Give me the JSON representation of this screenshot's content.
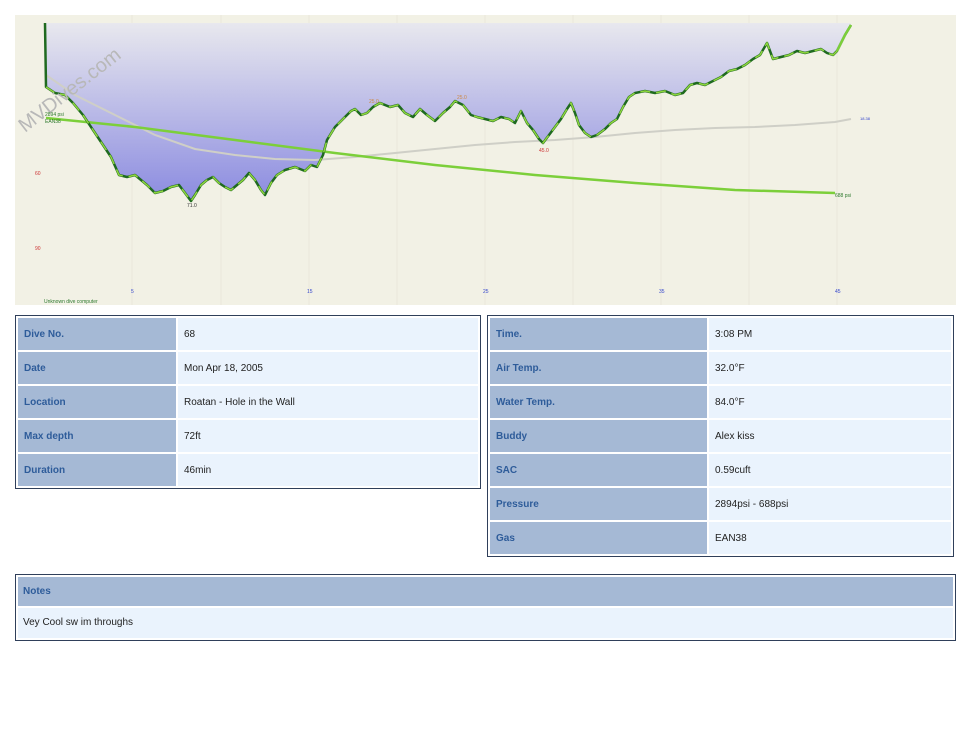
{
  "profile": {
    "watermark": "MVDives.com",
    "computer_label": "Unknown dive computer",
    "start_pressure_label": "2894 psi",
    "start_gas_label": "EAN38",
    "end_pressure_label": "688 psi",
    "temp_label": "18.38",
    "depth_ticks": [
      "60",
      "90"
    ],
    "time_ticks": [
      "5",
      "15",
      "25",
      "35",
      "45"
    ],
    "max_depth_label": "71.0",
    "mid_depth_label": "45.0",
    "peak_label_1": "25.0",
    "peak_label_2": "25.0",
    "colors": {
      "profile_fill_top": "#e6e6ee",
      "profile_fill_bottom": "#8e8ee0",
      "line_green": "#7ccf3a",
      "line_dark": "#1f6a1f",
      "line_yellow": "#d8d83a",
      "pressure": "#7ccf3a",
      "temp": "#cfcfc7",
      "background": "#f2f1e5",
      "axis_red": "#cc3333",
      "axis_blue": "#3344cc"
    }
  },
  "left": [
    {
      "label": "Dive No.",
      "value": "68"
    },
    {
      "label": "Date",
      "value": "Mon Apr 18, 2005"
    },
    {
      "label": "Location",
      "value": "Roatan - Hole in the Wall"
    },
    {
      "label": "Max depth",
      "value": "72ft"
    },
    {
      "label": "Duration",
      "value": "46min"
    }
  ],
  "right": [
    {
      "label": "Time.",
      "value": "3:08 PM"
    },
    {
      "label": "Air Temp.",
      "value": "32.0°F"
    },
    {
      "label": "Water Temp.",
      "value": "84.0°F"
    },
    {
      "label": "Buddy",
      "value": "Alex kiss"
    },
    {
      "label": "SAC",
      "value": "0.59cuft"
    },
    {
      "label": "Pressure",
      "value": "2894psi - 688psi"
    },
    {
      "label": "Gas",
      "value": "EAN38"
    }
  ],
  "notes": {
    "title": "Notes",
    "text": "Vey Cool sw im throughs"
  }
}
